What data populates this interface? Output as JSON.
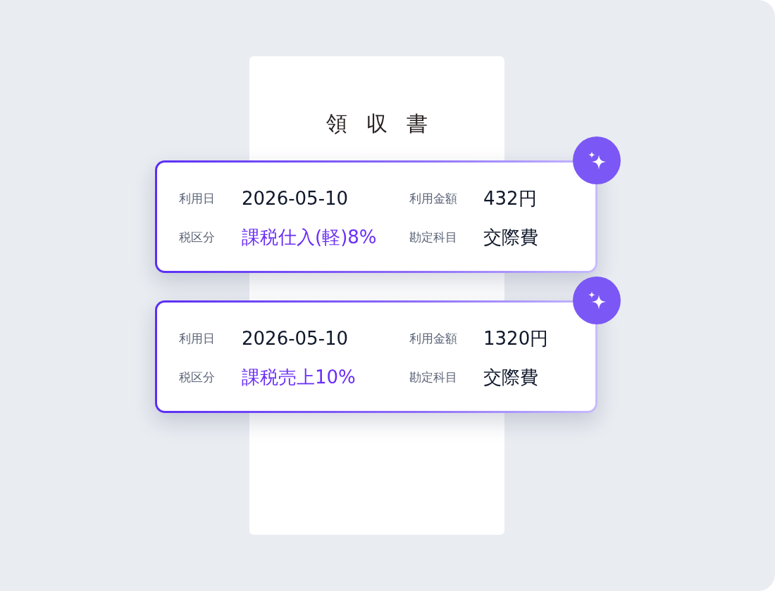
{
  "receipt": {
    "title": "領収書"
  },
  "cards": [
    {
      "fields": [
        {
          "label": "利用日",
          "value": "2026-05-10",
          "kind": "plain"
        },
        {
          "label": "利用金額",
          "value": "432円",
          "kind": "plain"
        },
        {
          "label": "税区分",
          "value": "課税仕入(軽)8%",
          "kind": "accent"
        },
        {
          "label": "勘定科目",
          "value": "交際費",
          "kind": "plain"
        }
      ]
    },
    {
      "fields": [
        {
          "label": "利用日",
          "value": "2026-05-10",
          "kind": "plain"
        },
        {
          "label": "利用金額",
          "value": "1320円",
          "kind": "plain"
        },
        {
          "label": "税区分",
          "value": "課税売上10%",
          "kind": "accent"
        },
        {
          "label": "勘定科目",
          "value": "交際費",
          "kind": "plain"
        }
      ]
    }
  ]
}
